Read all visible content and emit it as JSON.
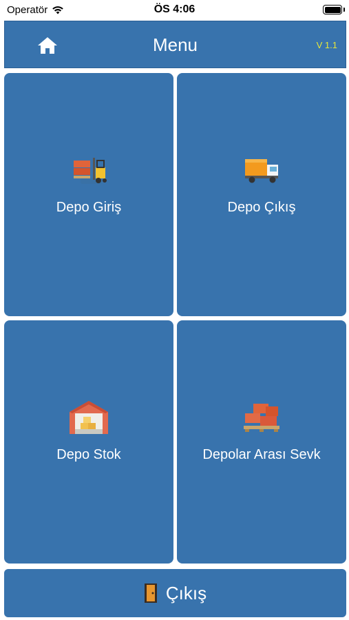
{
  "status_bar": {
    "carrier": "Operatör",
    "time": "ÖS 4:06"
  },
  "header": {
    "title": "Menu",
    "version": "V 1.1",
    "home_icon": "home-icon"
  },
  "tiles": [
    {
      "label": "Depo Giriş",
      "icon": "forklift-icon"
    },
    {
      "label": "Depo Çıkış",
      "icon": "truck-icon"
    },
    {
      "label": "Depo Stok",
      "icon": "warehouse-icon"
    },
    {
      "label": "Depolar Arası Sevk",
      "icon": "pallet-boxes-icon"
    }
  ],
  "exit": {
    "label": "Çıkış",
    "icon": "door-icon"
  },
  "colors": {
    "primary": "#3873ad",
    "version_text": "#e6e63a",
    "text": "#ffffff"
  }
}
